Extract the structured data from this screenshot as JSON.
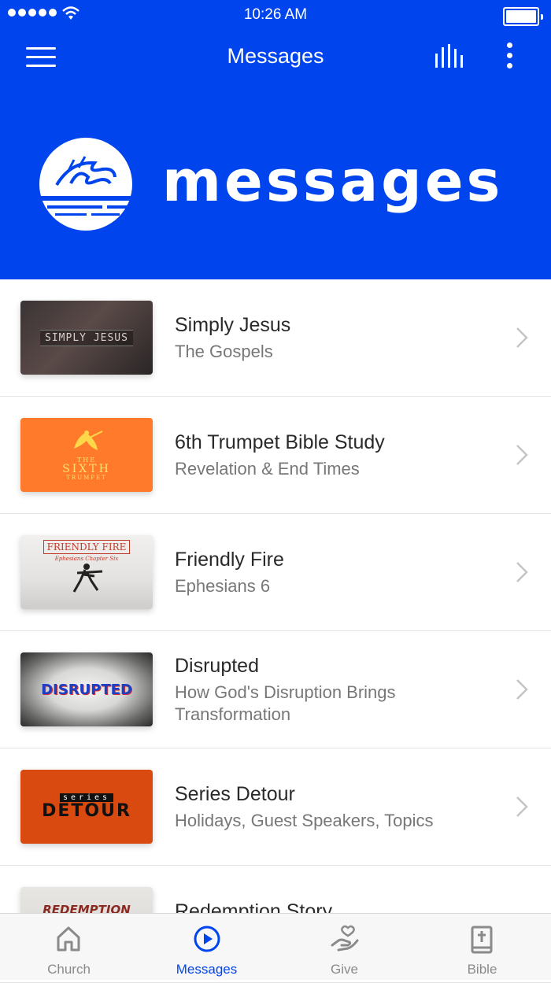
{
  "status_bar": {
    "time": "10:26 AM"
  },
  "nav": {
    "title": "Messages",
    "icons": [
      "menu-icon",
      "stats-icon",
      "more-icon"
    ]
  },
  "hero": {
    "wordmark": "messages"
  },
  "messages": [
    {
      "title": "Simply Jesus",
      "subtitle": "The Gospels",
      "thumb_text": "SIMPLY JESUS"
    },
    {
      "title": "6th Trumpet Bible Study",
      "subtitle": "Revelation & End Times",
      "thumb_text_1": "THE",
      "thumb_text_2": "SIXTH",
      "thumb_text_3": "TRUMPET"
    },
    {
      "title": "Friendly Fire",
      "subtitle": "Ephesians 6",
      "thumb_text": "FRIENDLY FIRE",
      "thumb_sub": "Ephesians Chapter Six"
    },
    {
      "title": "Disrupted",
      "subtitle": "How God's Disruption Brings Transformation",
      "thumb_text": "DISRUPTED"
    },
    {
      "title": "Series Detour",
      "subtitle": "Holidays, Guest Speakers, Topics",
      "thumb_text_1": "series",
      "thumb_text_2": "DETOUR"
    },
    {
      "title": "Redemption Story",
      "thumb_text": "REDEMPTION"
    }
  ],
  "tabs": [
    {
      "label": "Church",
      "icon": "home-icon"
    },
    {
      "label": "Messages",
      "icon": "play-circle-icon",
      "active": true
    },
    {
      "label": "Give",
      "icon": "give-heart-hand-icon"
    },
    {
      "label": "Bible",
      "icon": "bible-icon"
    }
  ],
  "colors": {
    "brand_blue": "#0044ee",
    "tab_inactive": "#8a8a8a",
    "detour_orange": "#d84a10",
    "trumpet_orange": "#ff7a2a"
  }
}
